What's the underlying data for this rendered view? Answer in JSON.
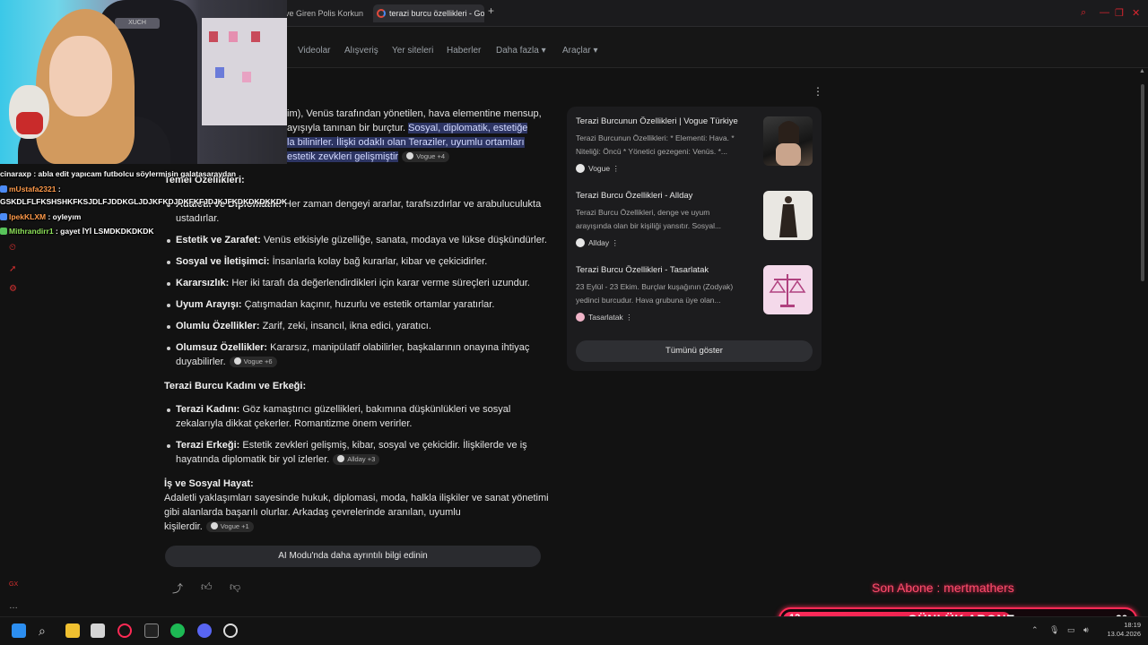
{
  "browser": {
    "tabs": [
      {
        "label": "ve Giren Polis Korkun"
      },
      {
        "label": "terazi burcu özellikleri - Go"
      }
    ],
    "new_tab_label": "+"
  },
  "google_nav": {
    "items": [
      "Videolar",
      "Alışveriş",
      "Yer siteleri",
      "Haberler",
      "Daha fazla",
      "Araçlar"
    ]
  },
  "overview": {
    "intro_line1": "im), Venüs tarafından yönetilen, hava elementine mensup,",
    "intro_line2_plain": "ayışıyla tanınan bir burçtur. ",
    "intro_line2_hl": "Sosyal, diplomatik, estetiğe",
    "intro_line3_hl": "la bilinirler. İlişki odaklı olan Teraziler, uyumlu ortamları",
    "intro_line4_hl": "estetik zevkleri gelişmiştir",
    "intro_cite": "Vogue +4",
    "temel_heading": "Temel Özellikleri:",
    "traits": [
      {
        "bold": "Adaletli ve Diplomatik:",
        "text": " Her zaman dengeyi ararlar, tarafsızdırlar ve arabuluculukta",
        "text2": "ustadırlar."
      },
      {
        "bold": "Estetik ve Zarafet:",
        "text": " Venüs etkisiyle güzelliğe, sanata, modaya ve lükse düşkündürler."
      },
      {
        "bold": "Sosyal ve İletişimci:",
        "text": " İnsanlarla kolay bağ kurarlar, kibar ve çekicidirler."
      },
      {
        "bold": "Kararsızlık:",
        "text": " Her iki tarafı da değerlendirdikleri için karar verme süreçleri uzundur."
      },
      {
        "bold": "Uyum Arayışı:",
        "text": " Çatışmadan kaçınır, huzurlu ve estetik ortamlar yaratırlar."
      },
      {
        "bold": "Olumlu Özellikler:",
        "text": " Zarif, zeki, insancıl, ikna edici, yaratıcı."
      },
      {
        "bold": "Olumsuz Özellikler:",
        "text": " Kararsız, manipülatif olabilirler, başkalarının onayına ihtiyaç",
        "text2": "duyabilirler.",
        "cite": "Vogue +6"
      }
    ],
    "gender_heading": "Terazi Burcu Kadını ve Erkeği:",
    "gender": [
      {
        "bold": "Terazi Kadını:",
        "text": " Göz kamaştırıcı güzellikleri, bakımına düşkünlükleri ve sosyal",
        "text2": "zekalarıyla dikkat çekerler. Romantizme önem verirler."
      },
      {
        "bold": "Terazi Erkeği:",
        "text": " Estetik zevkleri gelişmiş, kibar, sosyal ve çekicidir. İlişkilerde ve iş",
        "text2": "hayatında diplomatik bir yol izlerler.",
        "cite": "Allday +3"
      }
    ],
    "work_heading": "İş ve Sosyal Hayat:",
    "work_line1": "Adaletli yaklaşımları sayesinde hukuk, diplomasi, moda, halkla ilişkiler ve sanat yönetimi",
    "work_line2": "gibi alanlarda başarılı olurlar. Arkadaş çevrelerinde aranılan, uyumlu",
    "work_line3": "kişilerdir.",
    "work_cite": "Vogue +1",
    "ai_mode_button": "AI Modu'nda daha ayrıntılı bilgi edinin"
  },
  "sources": {
    "items": [
      {
        "title": "Terazi Burcunun Özellikleri | Vogue Türkiye",
        "desc1": "Terazi Burcunun Özellikleri: * Elementi: Hava. *",
        "desc2": "Niteliği: Öncü * Yönetici gezegeni: Venüs. *...",
        "site": "Vogue"
      },
      {
        "title": "Terazi Burcu Özellikleri - Allday",
        "desc1": "Terazi Burcu Özellikleri, denge ve uyum",
        "desc2": "arayışında olan bir kişiliği yansıtır. Sosyal...",
        "site": "Allday"
      },
      {
        "title": "Terazi Burcu Özellikleri - Tasarlatak",
        "desc1": "23 Eylül - 23 Ekim. Burçlar kuşağının (Zodyak)",
        "desc2": "yedinci burcudur. Hava grubuna üye olan...",
        "site": "Tasarlatak"
      }
    ],
    "show_all": "Tümünü göster"
  },
  "chat": [
    {
      "user": "cinaraxp",
      "msg": " : abla edit yapıcam futbolcu söylermisin galatasaraydan"
    },
    {
      "user": "mUstafa2321",
      "msg": " :"
    },
    {
      "user": "",
      "msg": "GSKDLFLFKSHSHKFKSJDLFJDDKGLJDJKFKDJDKFKFJDJKJFKDKDKDKKDK"
    },
    {
      "user": "IpekKLXM",
      "msg": " : oyleyım"
    },
    {
      "user": "Mithrandirr1",
      "msg": " : gayet İYİ LSMDKDKDKDK"
    }
  ],
  "overlay": {
    "son_abone": "Son Abone : mertmathers",
    "daily_label": "GÜNLÜK ABONE",
    "daily_current": "13",
    "daily_target": "20",
    "daily_progress": 0.65,
    "accent_color": "#ff2a55"
  },
  "camera": {
    "chair_brand": "XUCH"
  },
  "taskbar": {
    "time": "18:19",
    "date": "13.04.2026"
  }
}
